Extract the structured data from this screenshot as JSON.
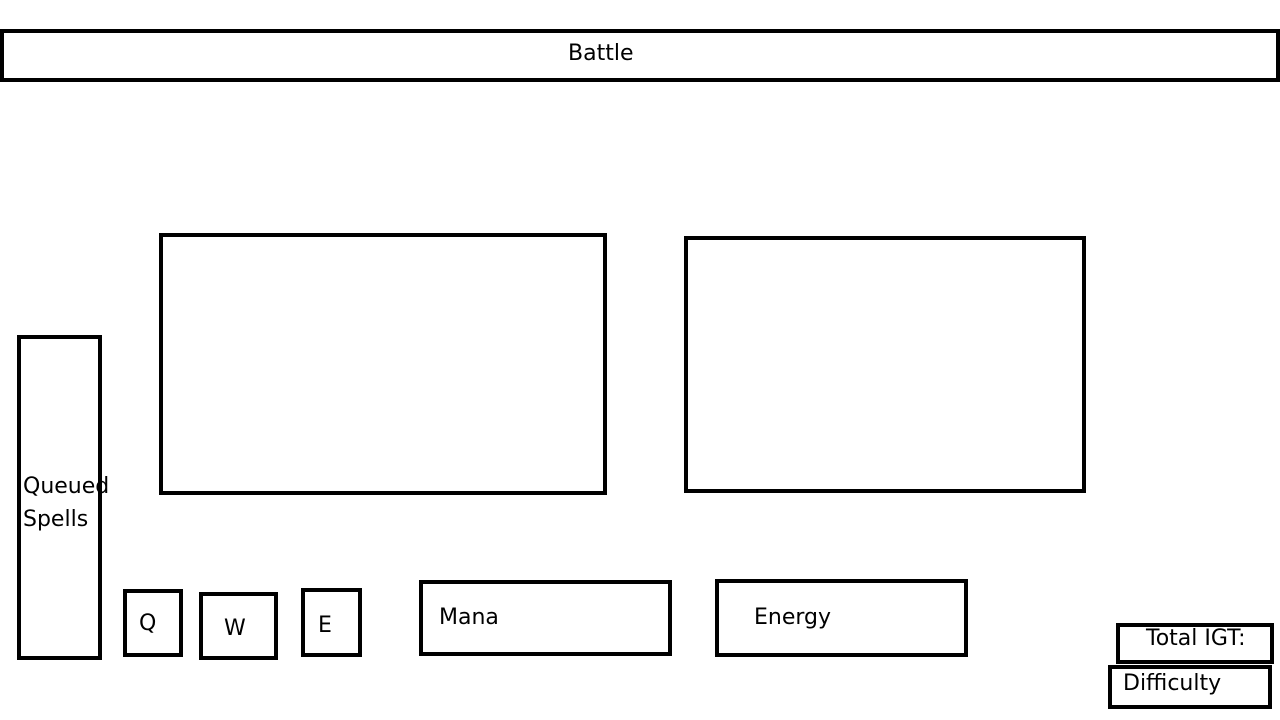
{
  "header": {
    "title": "Battle"
  },
  "queue": {
    "label": "Queued Spells"
  },
  "spell_keys": {
    "q": "Q",
    "w": "W",
    "e": "E"
  },
  "resources": {
    "mana_label": "Mana",
    "energy_label": "Energy"
  },
  "stats": {
    "igt_label": "Total IGT:",
    "difficulty_label": "Difficulty"
  }
}
